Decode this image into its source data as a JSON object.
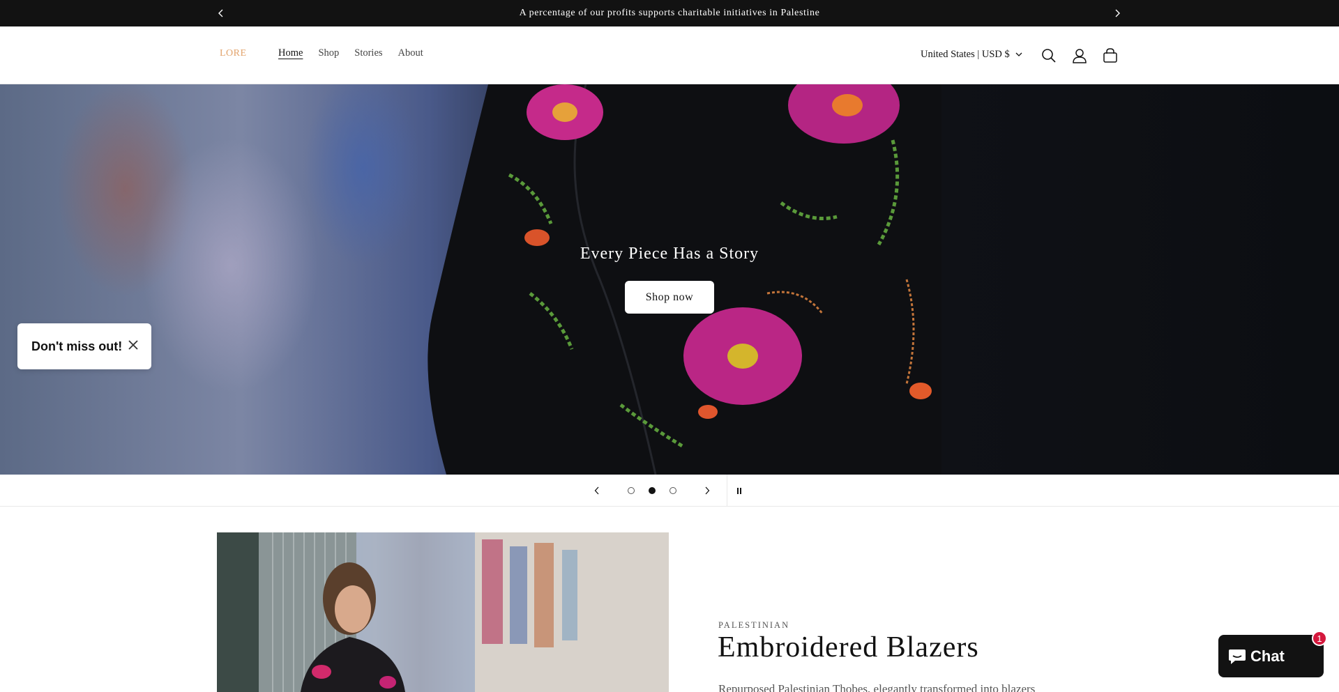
{
  "announcement": {
    "text": "A percentage of our profits supports charitable initiatives in Palestine"
  },
  "header": {
    "logo": "LORE",
    "nav": [
      {
        "label": "Home",
        "active": true
      },
      {
        "label": "Shop",
        "active": false
      },
      {
        "label": "Stories",
        "active": false
      },
      {
        "label": "About",
        "active": false
      }
    ],
    "country_selector": "United States | USD $",
    "icons": [
      "search-icon",
      "account-icon",
      "cart-icon"
    ]
  },
  "hero": {
    "title": "Every Piece Has a Story",
    "button_label": "Shop now"
  },
  "popup": {
    "text": "Don't miss out!"
  },
  "slider": {
    "slide_count": 3,
    "active_index": 1
  },
  "feature": {
    "kicker": "PALESTINIAN",
    "title": "Embroidered Blazers",
    "description": "Repurposed Palestinian Thobes, elegantly transformed into blazers"
  },
  "chat": {
    "label": "Chat",
    "badge_count": "1"
  },
  "colors": {
    "announcement_bg": "#121212",
    "logo": "#e2a36b",
    "chat_bg": "#121212",
    "badge": "#d4183d"
  }
}
